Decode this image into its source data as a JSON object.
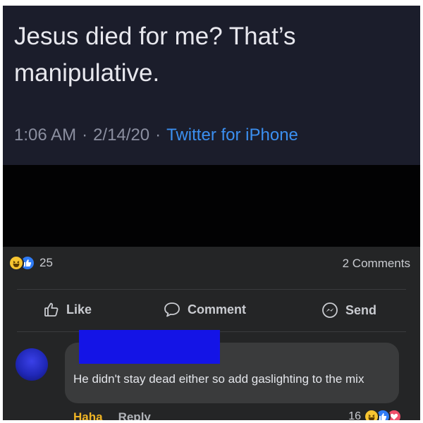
{
  "tweet": {
    "text": "Jesus died for me? That’s manipulative.",
    "time": "1:06 AM",
    "date": "2/14/20",
    "separator": "·",
    "source": "Twitter for iPhone"
  },
  "post": {
    "reaction_count": "25",
    "comments_count": "2 Comments",
    "actions": {
      "like": "Like",
      "comment": "Comment",
      "send": "Send"
    }
  },
  "comment": {
    "text": "He didn't stay dead either so add gaslighting to the mix",
    "reaction_label": "Haha",
    "reply_label": "Reply",
    "reaction_count": "16"
  },
  "colors": {
    "tweet_bg": "#1b1d2b",
    "link_blue": "#3b8ff0",
    "fb_bg": "#242526",
    "bubble_bg": "#3a3b3c",
    "haha_yellow": "#f7c531",
    "like_blue": "#2f7cf6",
    "love_red": "#f0506b",
    "redaction_blue": "#1414e6"
  },
  "icons": [
    "haha-icon",
    "like-icon",
    "love-icon",
    "thumbs-up-icon",
    "comment-icon",
    "messenger-icon"
  ]
}
